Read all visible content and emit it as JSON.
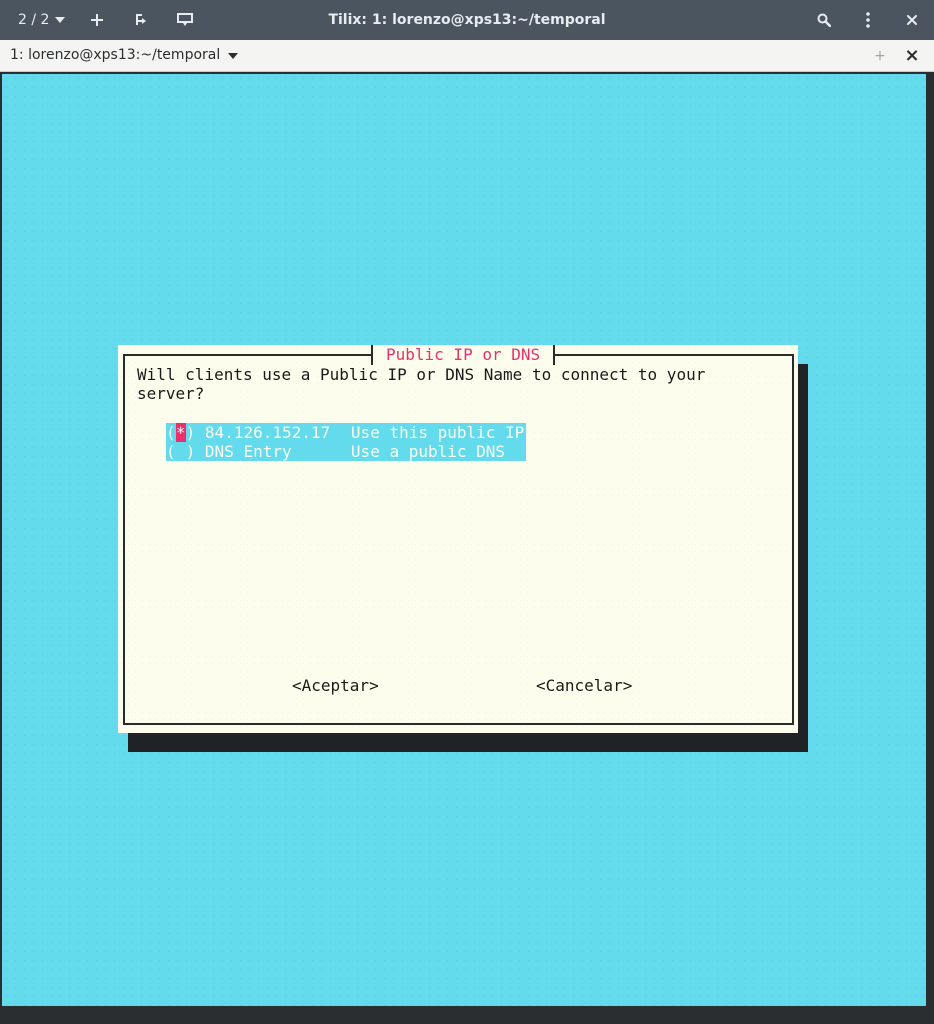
{
  "window": {
    "session_counter": "2 / 2",
    "title": "Tilix: 1: lorenzo@xps13:~/temporal"
  },
  "tab": {
    "title": "1: lorenzo@xps13:~/temporal",
    "add_glyph": "+",
    "close_glyph": "×"
  },
  "dialog": {
    "title": "Public IP or DNS",
    "prompt_line1": "Will clients use a Public IP or DNS Name to connect to your",
    "prompt_line2": "server?",
    "options": [
      {
        "open": "(",
        "mark": "*",
        "close": ")",
        "name": "84.126.152.17",
        "description": "Use this public IP",
        "selected": true
      },
      {
        "open": "(",
        "mark": " ",
        "close": ")",
        "name": "DNS Entry",
        "description": "Use a public DNS",
        "selected": false
      }
    ],
    "ok_label": "<Aceptar>",
    "cancel_label": "<Cancelar>"
  },
  "colors": {
    "terminal_background": "#63dbed",
    "dialog_background": "#fdfdee",
    "title_accent": "#e8306c",
    "headerbar": "#4a5560"
  },
  "icons": {
    "session_dropdown": "chevron-down-icon",
    "add_terminal": "plus-icon",
    "split": "split-terminal-icon",
    "sidebar": "session-sidebar-icon",
    "search": "search-icon",
    "menu": "kebab-menu-icon",
    "close": "close-icon"
  }
}
